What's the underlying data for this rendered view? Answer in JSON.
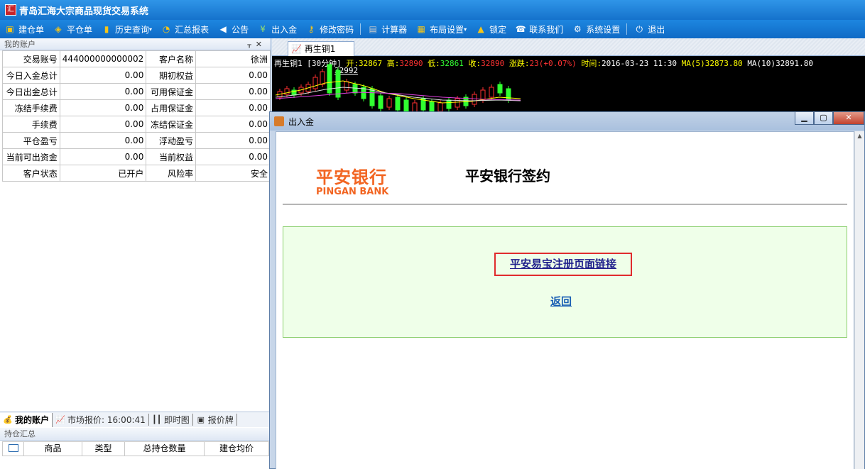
{
  "window": {
    "title": "青岛汇海大宗商品现货交易系统",
    "icon": "app-logo-icon"
  },
  "toolbar": {
    "items": [
      {
        "label": "建仓单",
        "icon": "cube-icon",
        "color": "#f5c518"
      },
      {
        "label": "平仓单",
        "icon": "box-open-icon",
        "color": "#f5c518"
      },
      {
        "label": "历史查询",
        "icon": "bar-chart-icon",
        "color": "#f5c518"
      },
      {
        "label": "汇总报表",
        "icon": "pie-chart-icon",
        "color": "#f5c518"
      },
      {
        "label": "公告",
        "icon": "speaker-icon",
        "color": "#ffffff"
      },
      {
        "label": "出入金",
        "icon": "money-icon",
        "color": "#9be36a"
      },
      {
        "label": "修改密码",
        "icon": "key-icon",
        "color": "#f5c518"
      },
      {
        "label": "计算器",
        "icon": "calculator-icon",
        "color": "#cccccc"
      },
      {
        "label": "布局设置",
        "icon": "layout-icon",
        "color": "#f5c518"
      },
      {
        "label": "锁定",
        "icon": "lock-icon",
        "color": "#f5c518"
      },
      {
        "label": "联系我们",
        "icon": "phone-icon",
        "color": "#ffffff"
      },
      {
        "label": "系统设置",
        "icon": "gear-icon",
        "color": "#ffffff"
      },
      {
        "label": "退出",
        "icon": "power-icon",
        "color": "#ffffff"
      }
    ]
  },
  "account_panel": {
    "title": "我的账户",
    "rows": [
      {
        "l1": "交易账号",
        "v1": "444000000000002",
        "l2": "客户名称",
        "v2": "徐洲"
      },
      {
        "l1": "今日入金总计",
        "v1": "0.00",
        "l2": "期初权益",
        "v2": "0.00"
      },
      {
        "l1": "今日出金总计",
        "v1": "0.00",
        "l2": "可用保证金",
        "v2": "0.00"
      },
      {
        "l1": "冻结手续费",
        "v1": "0.00",
        "l2": "占用保证金",
        "v2": "0.00"
      },
      {
        "l1": "手续费",
        "v1": "0.00",
        "l2": "冻结保证金",
        "v2": "0.00"
      },
      {
        "l1": "平仓盈亏",
        "v1": "0.00",
        "l2": "浮动盈亏",
        "v2": "0.00"
      },
      {
        "l1": "当前可出资金",
        "v1": "0.00",
        "l2": "当前权益",
        "v2": "0.00"
      },
      {
        "l1": "客户状态",
        "v1": "已开户",
        "l2": "风险率",
        "v2": "安全"
      }
    ]
  },
  "bottom_tabs": [
    {
      "label": "我的账户",
      "active": true
    },
    {
      "label": "市场报价: 16:00:41",
      "active": false
    },
    {
      "label": "即时图",
      "active": false
    },
    {
      "label": "报价牌",
      "active": false
    }
  ],
  "holdings": {
    "title": "持仓汇总",
    "columns": [
      "商品",
      "类型",
      "总持仓数量",
      "建仓均价"
    ]
  },
  "chart": {
    "tab_label": "再生铜1",
    "info": {
      "symbol": "再生铜1 [30分钟]",
      "open_label": "开:",
      "open": "32867",
      "high_label": "高:",
      "high": "32890",
      "low_label": "低:",
      "low": "32861",
      "close_label": "收:",
      "close": "32890",
      "change_label": "涨跌:",
      "change": "23(+0.07%)",
      "time_label": "时间:",
      "time": "2016-03-23 11:30",
      "ma5_label": "MA(5)",
      "ma5": "32873.80",
      "ma10_label": "MA(10)",
      "ma10": "32891.80",
      "peak_label": "32992"
    },
    "colors": {
      "up": "#ff3030",
      "down": "#30ff30",
      "ma5": "#ffff00",
      "ma10": "#ffffff"
    }
  },
  "dialog": {
    "title": "出入金",
    "bank_name_cn": "平安银行",
    "bank_name_en": "PINGAN BANK",
    "heading": "平安银行签约",
    "register_link": "平安易宝注册页面链接",
    "back_link": "返回"
  }
}
